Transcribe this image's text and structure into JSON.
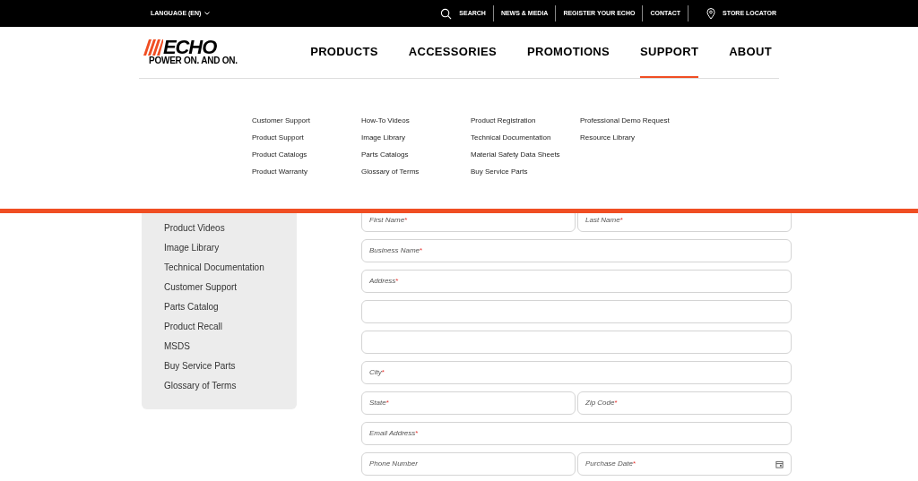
{
  "top_bar": {
    "language": "LANGUAGE (EN)",
    "links": [
      {
        "kind": "search",
        "label": "SEARCH"
      },
      {
        "kind": "text",
        "label": "NEWS & MEDIA"
      },
      {
        "kind": "text",
        "label": "REGISTER YOUR ECHO"
      },
      {
        "kind": "text",
        "label": "CONTACT"
      },
      {
        "kind": "locator",
        "label": "STORE LOCATOR"
      }
    ]
  },
  "logo": {
    "wordmark": "ECHO",
    "tagline": "POWER ON. AND ON."
  },
  "nav": [
    {
      "label": "PRODUCTS",
      "selected": false
    },
    {
      "label": "ACCESSORIES",
      "selected": false
    },
    {
      "label": "PROMOTIONS",
      "selected": false
    },
    {
      "label": "SUPPORT",
      "selected": true
    },
    {
      "label": "ABOUT",
      "selected": false
    }
  ],
  "mega_menu": [
    [
      "Customer Support",
      "Product Support",
      "Product Catalogs",
      "Product Warranty"
    ],
    [
      "How-To Videos",
      "Image Library",
      "Parts Catalogs",
      "Glossary of Terms"
    ],
    [
      "Product Registration",
      "Technical Documentation",
      "Material Safety Data Sheets",
      "Buy Service Parts"
    ],
    [
      "Professional Demo Request",
      "Resource Library"
    ]
  ],
  "sidebar": {
    "items": [
      "Product Videos",
      "Image Library",
      "Technical Documentation",
      "Customer Support",
      "Parts Catalog",
      "Product Recall",
      "MSDS",
      "Buy Service Parts",
      "Glossary of Terms"
    ]
  },
  "form": {
    "rows": [
      [
        {
          "kind": "text",
          "placeholder": "First Name",
          "required_mark": "*"
        },
        {
          "kind": "text",
          "placeholder": "Last Name",
          "required_mark": "*"
        }
      ],
      [
        {
          "kind": "text",
          "placeholder": "Business Name",
          "required_mark": "*"
        }
      ],
      [
        {
          "kind": "text",
          "placeholder": "Address",
          "required_mark": "*"
        }
      ],
      [
        {
          "kind": "text"
        }
      ],
      [
        {
          "kind": "text"
        }
      ],
      [
        {
          "kind": "text",
          "placeholder": "City",
          "required_mark": "*"
        }
      ],
      [
        {
          "kind": "text",
          "placeholder": "State",
          "required_mark": "*"
        },
        {
          "kind": "text",
          "placeholder": "Zip Code",
          "required_mark": "*"
        }
      ],
      [
        {
          "kind": "text",
          "placeholder": "Email Address",
          "required_mark": "*"
        }
      ],
      [
        {
          "kind": "text",
          "placeholder": "Phone Number"
        },
        {
          "kind": "date",
          "placeholder": "Purchase Date",
          "required_mark": "*"
        }
      ]
    ]
  }
}
